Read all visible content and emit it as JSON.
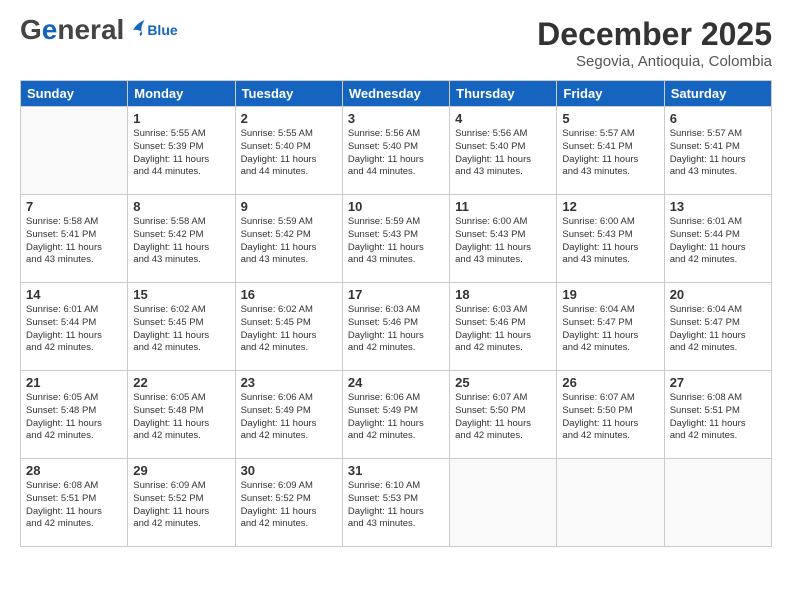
{
  "header": {
    "logo_general": "General",
    "logo_blue": "Blue",
    "month_title": "December 2025",
    "location": "Segovia, Antioquia, Colombia"
  },
  "days_of_week": [
    "Sunday",
    "Monday",
    "Tuesday",
    "Wednesday",
    "Thursday",
    "Friday",
    "Saturday"
  ],
  "weeks": [
    [
      {
        "day": "",
        "info": ""
      },
      {
        "day": "1",
        "info": "Sunrise: 5:55 AM\nSunset: 5:39 PM\nDaylight: 11 hours\nand 44 minutes."
      },
      {
        "day": "2",
        "info": "Sunrise: 5:55 AM\nSunset: 5:40 PM\nDaylight: 11 hours\nand 44 minutes."
      },
      {
        "day": "3",
        "info": "Sunrise: 5:56 AM\nSunset: 5:40 PM\nDaylight: 11 hours\nand 44 minutes."
      },
      {
        "day": "4",
        "info": "Sunrise: 5:56 AM\nSunset: 5:40 PM\nDaylight: 11 hours\nand 43 minutes."
      },
      {
        "day": "5",
        "info": "Sunrise: 5:57 AM\nSunset: 5:41 PM\nDaylight: 11 hours\nand 43 minutes."
      },
      {
        "day": "6",
        "info": "Sunrise: 5:57 AM\nSunset: 5:41 PM\nDaylight: 11 hours\nand 43 minutes."
      }
    ],
    [
      {
        "day": "7",
        "info": "Sunrise: 5:58 AM\nSunset: 5:41 PM\nDaylight: 11 hours\nand 43 minutes."
      },
      {
        "day": "8",
        "info": "Sunrise: 5:58 AM\nSunset: 5:42 PM\nDaylight: 11 hours\nand 43 minutes."
      },
      {
        "day": "9",
        "info": "Sunrise: 5:59 AM\nSunset: 5:42 PM\nDaylight: 11 hours\nand 43 minutes."
      },
      {
        "day": "10",
        "info": "Sunrise: 5:59 AM\nSunset: 5:43 PM\nDaylight: 11 hours\nand 43 minutes."
      },
      {
        "day": "11",
        "info": "Sunrise: 6:00 AM\nSunset: 5:43 PM\nDaylight: 11 hours\nand 43 minutes."
      },
      {
        "day": "12",
        "info": "Sunrise: 6:00 AM\nSunset: 5:43 PM\nDaylight: 11 hours\nand 43 minutes."
      },
      {
        "day": "13",
        "info": "Sunrise: 6:01 AM\nSunset: 5:44 PM\nDaylight: 11 hours\nand 42 minutes."
      }
    ],
    [
      {
        "day": "14",
        "info": "Sunrise: 6:01 AM\nSunset: 5:44 PM\nDaylight: 11 hours\nand 42 minutes."
      },
      {
        "day": "15",
        "info": "Sunrise: 6:02 AM\nSunset: 5:45 PM\nDaylight: 11 hours\nand 42 minutes."
      },
      {
        "day": "16",
        "info": "Sunrise: 6:02 AM\nSunset: 5:45 PM\nDaylight: 11 hours\nand 42 minutes."
      },
      {
        "day": "17",
        "info": "Sunrise: 6:03 AM\nSunset: 5:46 PM\nDaylight: 11 hours\nand 42 minutes."
      },
      {
        "day": "18",
        "info": "Sunrise: 6:03 AM\nSunset: 5:46 PM\nDaylight: 11 hours\nand 42 minutes."
      },
      {
        "day": "19",
        "info": "Sunrise: 6:04 AM\nSunset: 5:47 PM\nDaylight: 11 hours\nand 42 minutes."
      },
      {
        "day": "20",
        "info": "Sunrise: 6:04 AM\nSunset: 5:47 PM\nDaylight: 11 hours\nand 42 minutes."
      }
    ],
    [
      {
        "day": "21",
        "info": "Sunrise: 6:05 AM\nSunset: 5:48 PM\nDaylight: 11 hours\nand 42 minutes."
      },
      {
        "day": "22",
        "info": "Sunrise: 6:05 AM\nSunset: 5:48 PM\nDaylight: 11 hours\nand 42 minutes."
      },
      {
        "day": "23",
        "info": "Sunrise: 6:06 AM\nSunset: 5:49 PM\nDaylight: 11 hours\nand 42 minutes."
      },
      {
        "day": "24",
        "info": "Sunrise: 6:06 AM\nSunset: 5:49 PM\nDaylight: 11 hours\nand 42 minutes."
      },
      {
        "day": "25",
        "info": "Sunrise: 6:07 AM\nSunset: 5:50 PM\nDaylight: 11 hours\nand 42 minutes."
      },
      {
        "day": "26",
        "info": "Sunrise: 6:07 AM\nSunset: 5:50 PM\nDaylight: 11 hours\nand 42 minutes."
      },
      {
        "day": "27",
        "info": "Sunrise: 6:08 AM\nSunset: 5:51 PM\nDaylight: 11 hours\nand 42 minutes."
      }
    ],
    [
      {
        "day": "28",
        "info": "Sunrise: 6:08 AM\nSunset: 5:51 PM\nDaylight: 11 hours\nand 42 minutes."
      },
      {
        "day": "29",
        "info": "Sunrise: 6:09 AM\nSunset: 5:52 PM\nDaylight: 11 hours\nand 42 minutes."
      },
      {
        "day": "30",
        "info": "Sunrise: 6:09 AM\nSunset: 5:52 PM\nDaylight: 11 hours\nand 42 minutes."
      },
      {
        "day": "31",
        "info": "Sunrise: 6:10 AM\nSunset: 5:53 PM\nDaylight: 11 hours\nand 43 minutes."
      },
      {
        "day": "",
        "info": ""
      },
      {
        "day": "",
        "info": ""
      },
      {
        "day": "",
        "info": ""
      }
    ]
  ]
}
